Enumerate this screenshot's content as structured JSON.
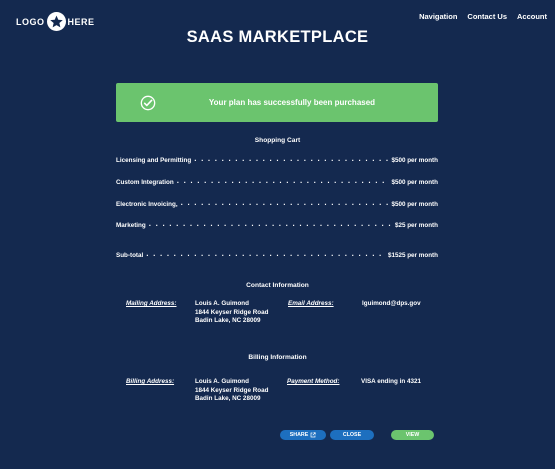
{
  "header": {
    "logo_left": "LOGO",
    "logo_right": "HERE",
    "nav": [
      "Navigation",
      "Contact Us",
      "Account"
    ],
    "title": "SAAS MARKETPLACE"
  },
  "banner": {
    "message": "Your plan has successfully been purchased",
    "color": "#6bc46e"
  },
  "cart": {
    "heading": "Shopping Cart",
    "items": [
      {
        "name": "Licensing and Permitting",
        "price": "$500 per month"
      },
      {
        "name": "Custom Integration",
        "price": "$500 per month"
      },
      {
        "name": "Electronic Invoicing,",
        "price": "$500 per month"
      },
      {
        "name": "Marketing",
        "price": "$25 per month"
      }
    ],
    "subtotal": {
      "name": "Sub-total",
      "price": "$1525 per month"
    }
  },
  "contact": {
    "heading": "Contact Information",
    "mailing_label": "Mailing Address:",
    "name": "Louis A. Guimond",
    "street": "1844 Keyser Ridge Road",
    "city": "Badin Lake, NC 28009",
    "email_label": "Email Address:",
    "email": "lguimond@dps.gov"
  },
  "billing": {
    "heading": "Billing Information",
    "billing_label": "Billing Address:",
    "name": "Louis A. Guimond",
    "street": "1844 Keyser Ridge Road",
    "city": "Badin Lake, NC 28009",
    "payment_label": "Payment Method:",
    "payment": "VISA ending in 4321"
  },
  "buttons": {
    "share": "SHARE",
    "close": "CLOSE",
    "view": "VIEW"
  },
  "colors": {
    "background": "#14294f",
    "accent_blue": "#1d6fbf",
    "success_green": "#6bc46e"
  }
}
